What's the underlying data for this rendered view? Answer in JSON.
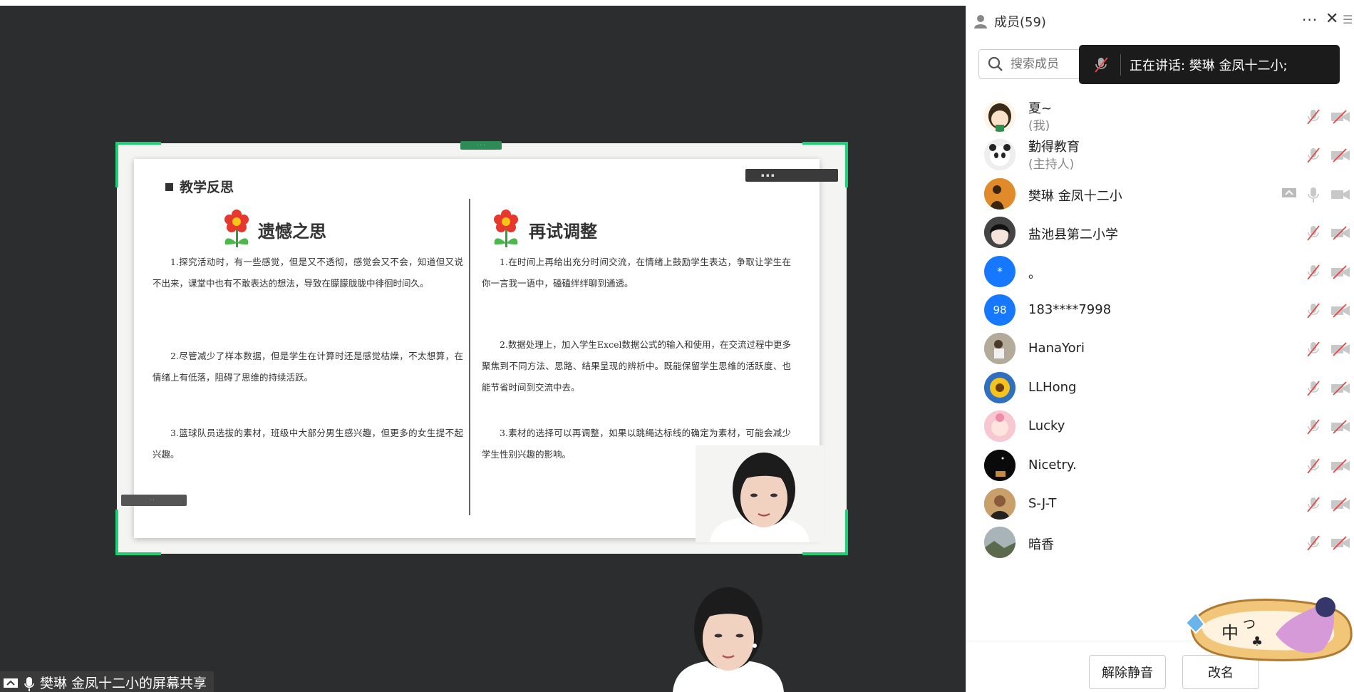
{
  "colors": {
    "accent": "#1fcf75",
    "dark_bg": "#2b2d2f",
    "blue_avatar": "#1677ff"
  },
  "slide": {
    "header": "教学反思",
    "left_title": "遗憾之思",
    "right_title": "再试调整",
    "left_paras": [
      "1.探究活动时，有一些感觉，但是又不透彻，感觉会又不会，知道但又说不出来，课堂中也有不敢表达的想法，导致在朦朦胧胧中徘徊时间久。",
      "2.尽管减少了样本数据，但是学生在计算时还是感觉枯燥，不太想算，在情绪上有低落，阻碍了思维的持续活跃。",
      "3.篮球队员选拔的素材，班级中大部分男生感兴趣，但更多的女生提不起兴趣。"
    ],
    "right_paras": [
      "1.在时间上再给出充分时间交流，在情绪上鼓励学生表达，争取让学生在你一言我一语中，磕磕绊绊聊到通透。",
      "2.数据处理上，加入学生Excel数据公式的输入和使用，在交流过程中更多聚焦到不同方法、思路、结果呈现的辨析中。既能保留学生思维的活跃度、也能节省时间到交流中去。",
      "3.素材的选择可以再调整，如果以跳绳达标线的确定为素材，可能会减少学生性别兴趣的影响。"
    ]
  },
  "share_label": "樊琳 金凤十二小的屏幕共享",
  "panel": {
    "title": "成员(59)",
    "more": "···",
    "close": "✕",
    "search_placeholder": "搜索成员",
    "speaking": "正在讲话: 樊琳 金凤十二小;"
  },
  "members": [
    {
      "name": "夏~",
      "sub": "(我)",
      "mic": "muted",
      "cam": "off",
      "avatar": "cartoon-girl"
    },
    {
      "name": "勤得教育",
      "sub": "(主持人)",
      "mic": "muted",
      "cam": "off",
      "avatar": "panda"
    },
    {
      "name": "樊琳 金凤十二小",
      "sub": "",
      "mic": "on",
      "cam": "off",
      "share": true,
      "avatar": "silhouette"
    },
    {
      "name": "盐池县第二小学",
      "sub": "",
      "mic": "muted",
      "cam": "off",
      "avatar": "anime"
    },
    {
      "name": "。",
      "sub": "",
      "mic": "muted",
      "cam": "off",
      "avatar": "blue",
      "avatar_text": "*"
    },
    {
      "name": "183****7998",
      "sub": "",
      "mic": "muted",
      "cam": "off",
      "avatar": "blue",
      "avatar_text": "98"
    },
    {
      "name": "HanaYori",
      "sub": "",
      "mic": "muted",
      "cam": "off",
      "avatar": "photo"
    },
    {
      "name": "LLHong",
      "sub": "",
      "mic": "muted",
      "cam": "off",
      "avatar": "sunflower"
    },
    {
      "name": "Lucky",
      "sub": "",
      "mic": "muted",
      "cam": "off",
      "avatar": "baby"
    },
    {
      "name": "Nicetry.",
      "sub": "",
      "mic": "muted",
      "cam": "off",
      "avatar": "night"
    },
    {
      "name": "S-J-T",
      "sub": "",
      "mic": "muted",
      "cam": "off",
      "avatar": "man"
    },
    {
      "name": "暗香",
      "sub": "",
      "mic": "muted",
      "cam": "off",
      "avatar": "scenery"
    }
  ],
  "footer": {
    "unmute": "解除静音",
    "rename": "改名"
  }
}
